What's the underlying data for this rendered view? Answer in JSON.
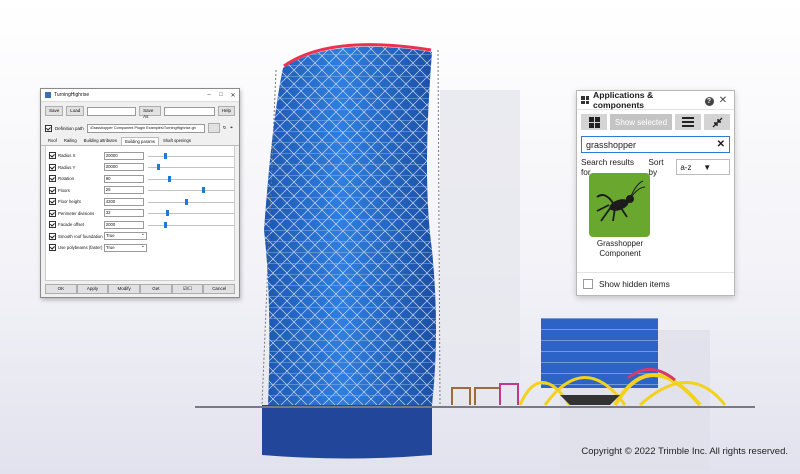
{
  "dialog": {
    "title": "TurningHighrise",
    "window_buttons": [
      "–",
      "□",
      "✕"
    ],
    "save": "Save",
    "load": "Load",
    "preset_value": "",
    "save_as": "Save As",
    "save_as_value": "",
    "help": "Help",
    "definition_label": "Definition path",
    "definition_value": "\\Grasshopper Component Plugin Examples\\TurningHighrise.gh",
    "tabs": [
      "Roof",
      "Railing",
      "Building attributes",
      "Building params",
      "Shaft openings"
    ],
    "active_tab": 3,
    "params": [
      {
        "label": "Radius X",
        "value": "20000",
        "slider": 0.2
      },
      {
        "label": "Radius Y",
        "value": "20000",
        "slider": 0.12
      },
      {
        "label": "Rotation",
        "value": "90",
        "slider": 0.25
      },
      {
        "label": "Floors",
        "value": "25",
        "slider": 0.64
      },
      {
        "label": "Floor height",
        "value": "4200",
        "slider": 0.45
      },
      {
        "label": "Perimeter divisions",
        "value": "32",
        "slider": 0.22
      },
      {
        "label": "Facade offset",
        "value": "2000",
        "slider": 0.2
      }
    ],
    "selects": [
      {
        "label": "Smooth roof foundation",
        "value": "True"
      },
      {
        "label": "Use polybeams (faster)",
        "value": "True"
      }
    ],
    "footer": [
      "OK",
      "Apply",
      "Modify",
      "Get",
      "☑/☐",
      "Cancel"
    ]
  },
  "apps": {
    "title": "Applications & components",
    "show_selected": "Show selected",
    "search_value": "grasshopper",
    "results_label": "Search results for",
    "sort_label": "Sort by",
    "sort_value": "a-z",
    "tile_line1": "Grasshopper",
    "tile_line2": "Component",
    "show_hidden": "Show hidden items",
    "tile_color": "#6aa72f"
  },
  "copyright": "Copyright © 2022 Trimble Inc. All rights reserved."
}
